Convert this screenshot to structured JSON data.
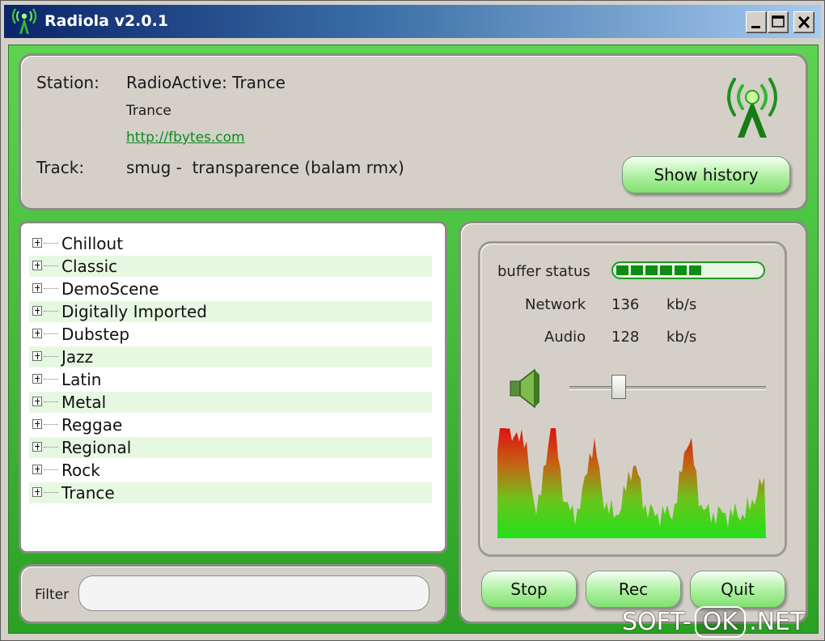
{
  "window": {
    "title": "Radiola v2.0.1",
    "accent_color": "#3cbf34"
  },
  "station_panel": {
    "station_label": "Station:",
    "station_name": "RadioActive: Trance",
    "genre": "Trance",
    "url": "http://fbytes.com",
    "track_label": "Track:",
    "track": "smug -  transparence (balam rmx)",
    "show_history_label": "Show history",
    "logo_icon": "radio-tower-icon"
  },
  "genres": [
    {
      "label": "Chillout"
    },
    {
      "label": "Classic"
    },
    {
      "label": "DemoScene"
    },
    {
      "label": "Digitally Imported"
    },
    {
      "label": "Dubstep"
    },
    {
      "label": "Jazz"
    },
    {
      "label": "Latin"
    },
    {
      "label": "Metal"
    },
    {
      "label": "Reggae"
    },
    {
      "label": "Regional"
    },
    {
      "label": "Rock"
    },
    {
      "label": "Trance"
    }
  ],
  "filter": {
    "label": "Filter",
    "value": ""
  },
  "status": {
    "buffer_label": "buffer status",
    "buffer_fraction": 0.6,
    "network_label": "Network",
    "network_value": "136",
    "network_unit": "kb/s",
    "audio_label": "Audio",
    "audio_value": "128",
    "audio_unit": "kb/s",
    "volume_fraction": 0.25,
    "speaker_icon": "speaker-icon"
  },
  "controls": {
    "stop_label": "Stop",
    "rec_label": "Rec",
    "quit_label": "Quit"
  },
  "watermark": {
    "left": "SOFT-",
    "box": "OK",
    "right": ".NET"
  }
}
